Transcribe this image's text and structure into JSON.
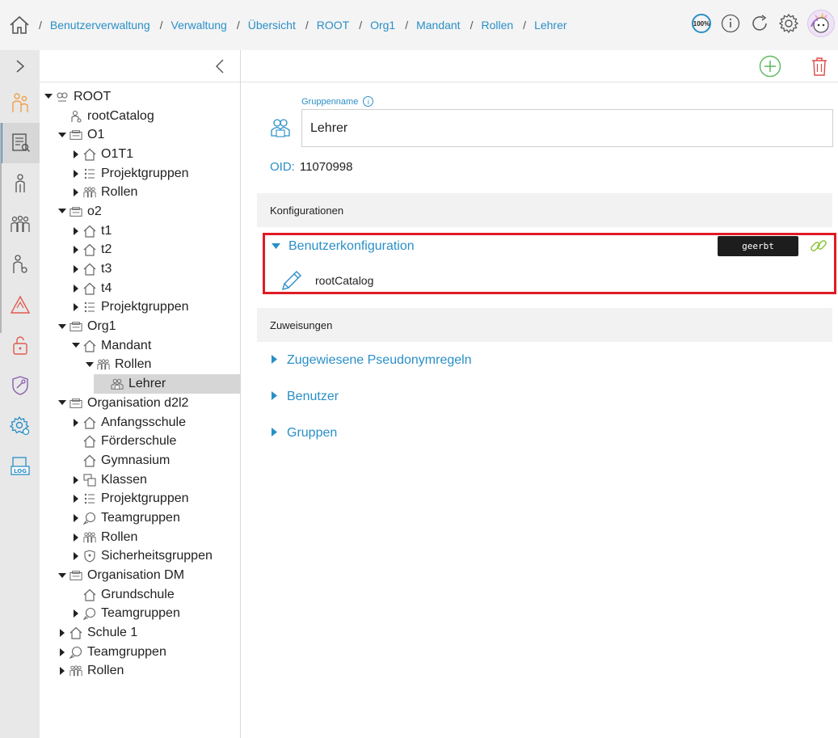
{
  "breadcrumb": [
    "Benutzerverwaltung",
    "Verwaltung",
    "Übersicht",
    "ROOT",
    "Org1",
    "Mandant",
    "Rollen",
    "Lehrer"
  ],
  "header": {
    "zoom": "100%"
  },
  "tree": [
    {
      "label": "ROOT",
      "level": 0,
      "expander": "down",
      "icon": "org-icon"
    },
    {
      "label": "rootCatalog",
      "level": 1,
      "expander": "none",
      "icon": "catalog-icon"
    },
    {
      "label": "O1",
      "level": 1,
      "expander": "down",
      "icon": "organisation-icon"
    },
    {
      "label": "O1T1",
      "level": 2,
      "expander": "right",
      "icon": "house-icon"
    },
    {
      "label": "Projektgruppen",
      "level": 2,
      "expander": "right",
      "icon": "list-icon"
    },
    {
      "label": "Rollen",
      "level": 2,
      "expander": "right",
      "icon": "roles-icon"
    },
    {
      "label": "o2",
      "level": 1,
      "expander": "down",
      "icon": "organisation-icon"
    },
    {
      "label": "t1",
      "level": 2,
      "expander": "right",
      "icon": "house-icon"
    },
    {
      "label": "t2",
      "level": 2,
      "expander": "right",
      "icon": "house-icon"
    },
    {
      "label": "t3",
      "level": 2,
      "expander": "right",
      "icon": "house-icon"
    },
    {
      "label": "t4",
      "level": 2,
      "expander": "right",
      "icon": "house-icon"
    },
    {
      "label": "Projektgruppen",
      "level": 2,
      "expander": "right",
      "icon": "list-icon"
    },
    {
      "label": "Org1",
      "level": 1,
      "expander": "down",
      "icon": "organisation-icon"
    },
    {
      "label": "Mandant",
      "level": 2,
      "expander": "down",
      "icon": "house-icon"
    },
    {
      "label": "Rollen",
      "level": 3,
      "expander": "down",
      "icon": "roles-icon"
    },
    {
      "label": "Lehrer",
      "level": 4,
      "expander": "none",
      "icon": "group-icon",
      "selected": true
    },
    {
      "label": "Organisation d2l2",
      "level": 1,
      "expander": "down",
      "icon": "organisation-icon"
    },
    {
      "label": "Anfangsschule",
      "level": 2,
      "expander": "right",
      "icon": "house-icon"
    },
    {
      "label": "Förderschule",
      "level": 2,
      "expander": "none",
      "icon": "house-icon"
    },
    {
      "label": "Gymnasium",
      "level": 2,
      "expander": "none",
      "icon": "house-icon"
    },
    {
      "label": "Klassen",
      "level": 2,
      "expander": "right",
      "icon": "classes-icon"
    },
    {
      "label": "Projektgruppen",
      "level": 2,
      "expander": "right",
      "icon": "list-icon"
    },
    {
      "label": "Teamgruppen",
      "level": 2,
      "expander": "right",
      "icon": "chat-icon"
    },
    {
      "label": "Rollen",
      "level": 2,
      "expander": "right",
      "icon": "roles-icon"
    },
    {
      "label": "Sicherheitsgruppen",
      "level": 2,
      "expander": "right",
      "icon": "shield-icon"
    },
    {
      "label": "Organisation DM",
      "level": 1,
      "expander": "down",
      "icon": "organisation-icon"
    },
    {
      "label": "Grundschule",
      "level": 2,
      "expander": "none",
      "icon": "house-icon"
    },
    {
      "label": "Teamgruppen",
      "level": 2,
      "expander": "right",
      "icon": "chat-icon"
    },
    {
      "label": "Schule 1",
      "level": 1,
      "expander": "right",
      "icon": "house-icon"
    },
    {
      "label": "Teamgruppen",
      "level": 1,
      "expander": "right",
      "icon": "chat-icon"
    },
    {
      "label": "Rollen",
      "level": 1,
      "expander": "right",
      "icon": "roles-icon"
    }
  ],
  "form": {
    "group_name_label": "Gruppenname",
    "group_name_value": "Lehrer",
    "oid_label": "OID:",
    "oid_value": "11070998"
  },
  "configurations": {
    "section_title": "Konfigurationen",
    "item_title": "Benutzerkonfiguration",
    "inherited_badge": "geerbt",
    "entry": "rootCatalog"
  },
  "assignments": {
    "section_title": "Zuweisungen",
    "items": [
      "Zugewiesene Pseudonymregeln",
      "Benutzer",
      "Gruppen"
    ]
  },
  "colors": {
    "accent": "#2a8fc7",
    "add": "#5cb85c",
    "delete": "#e04848",
    "highlight_box": "#e01b24"
  }
}
